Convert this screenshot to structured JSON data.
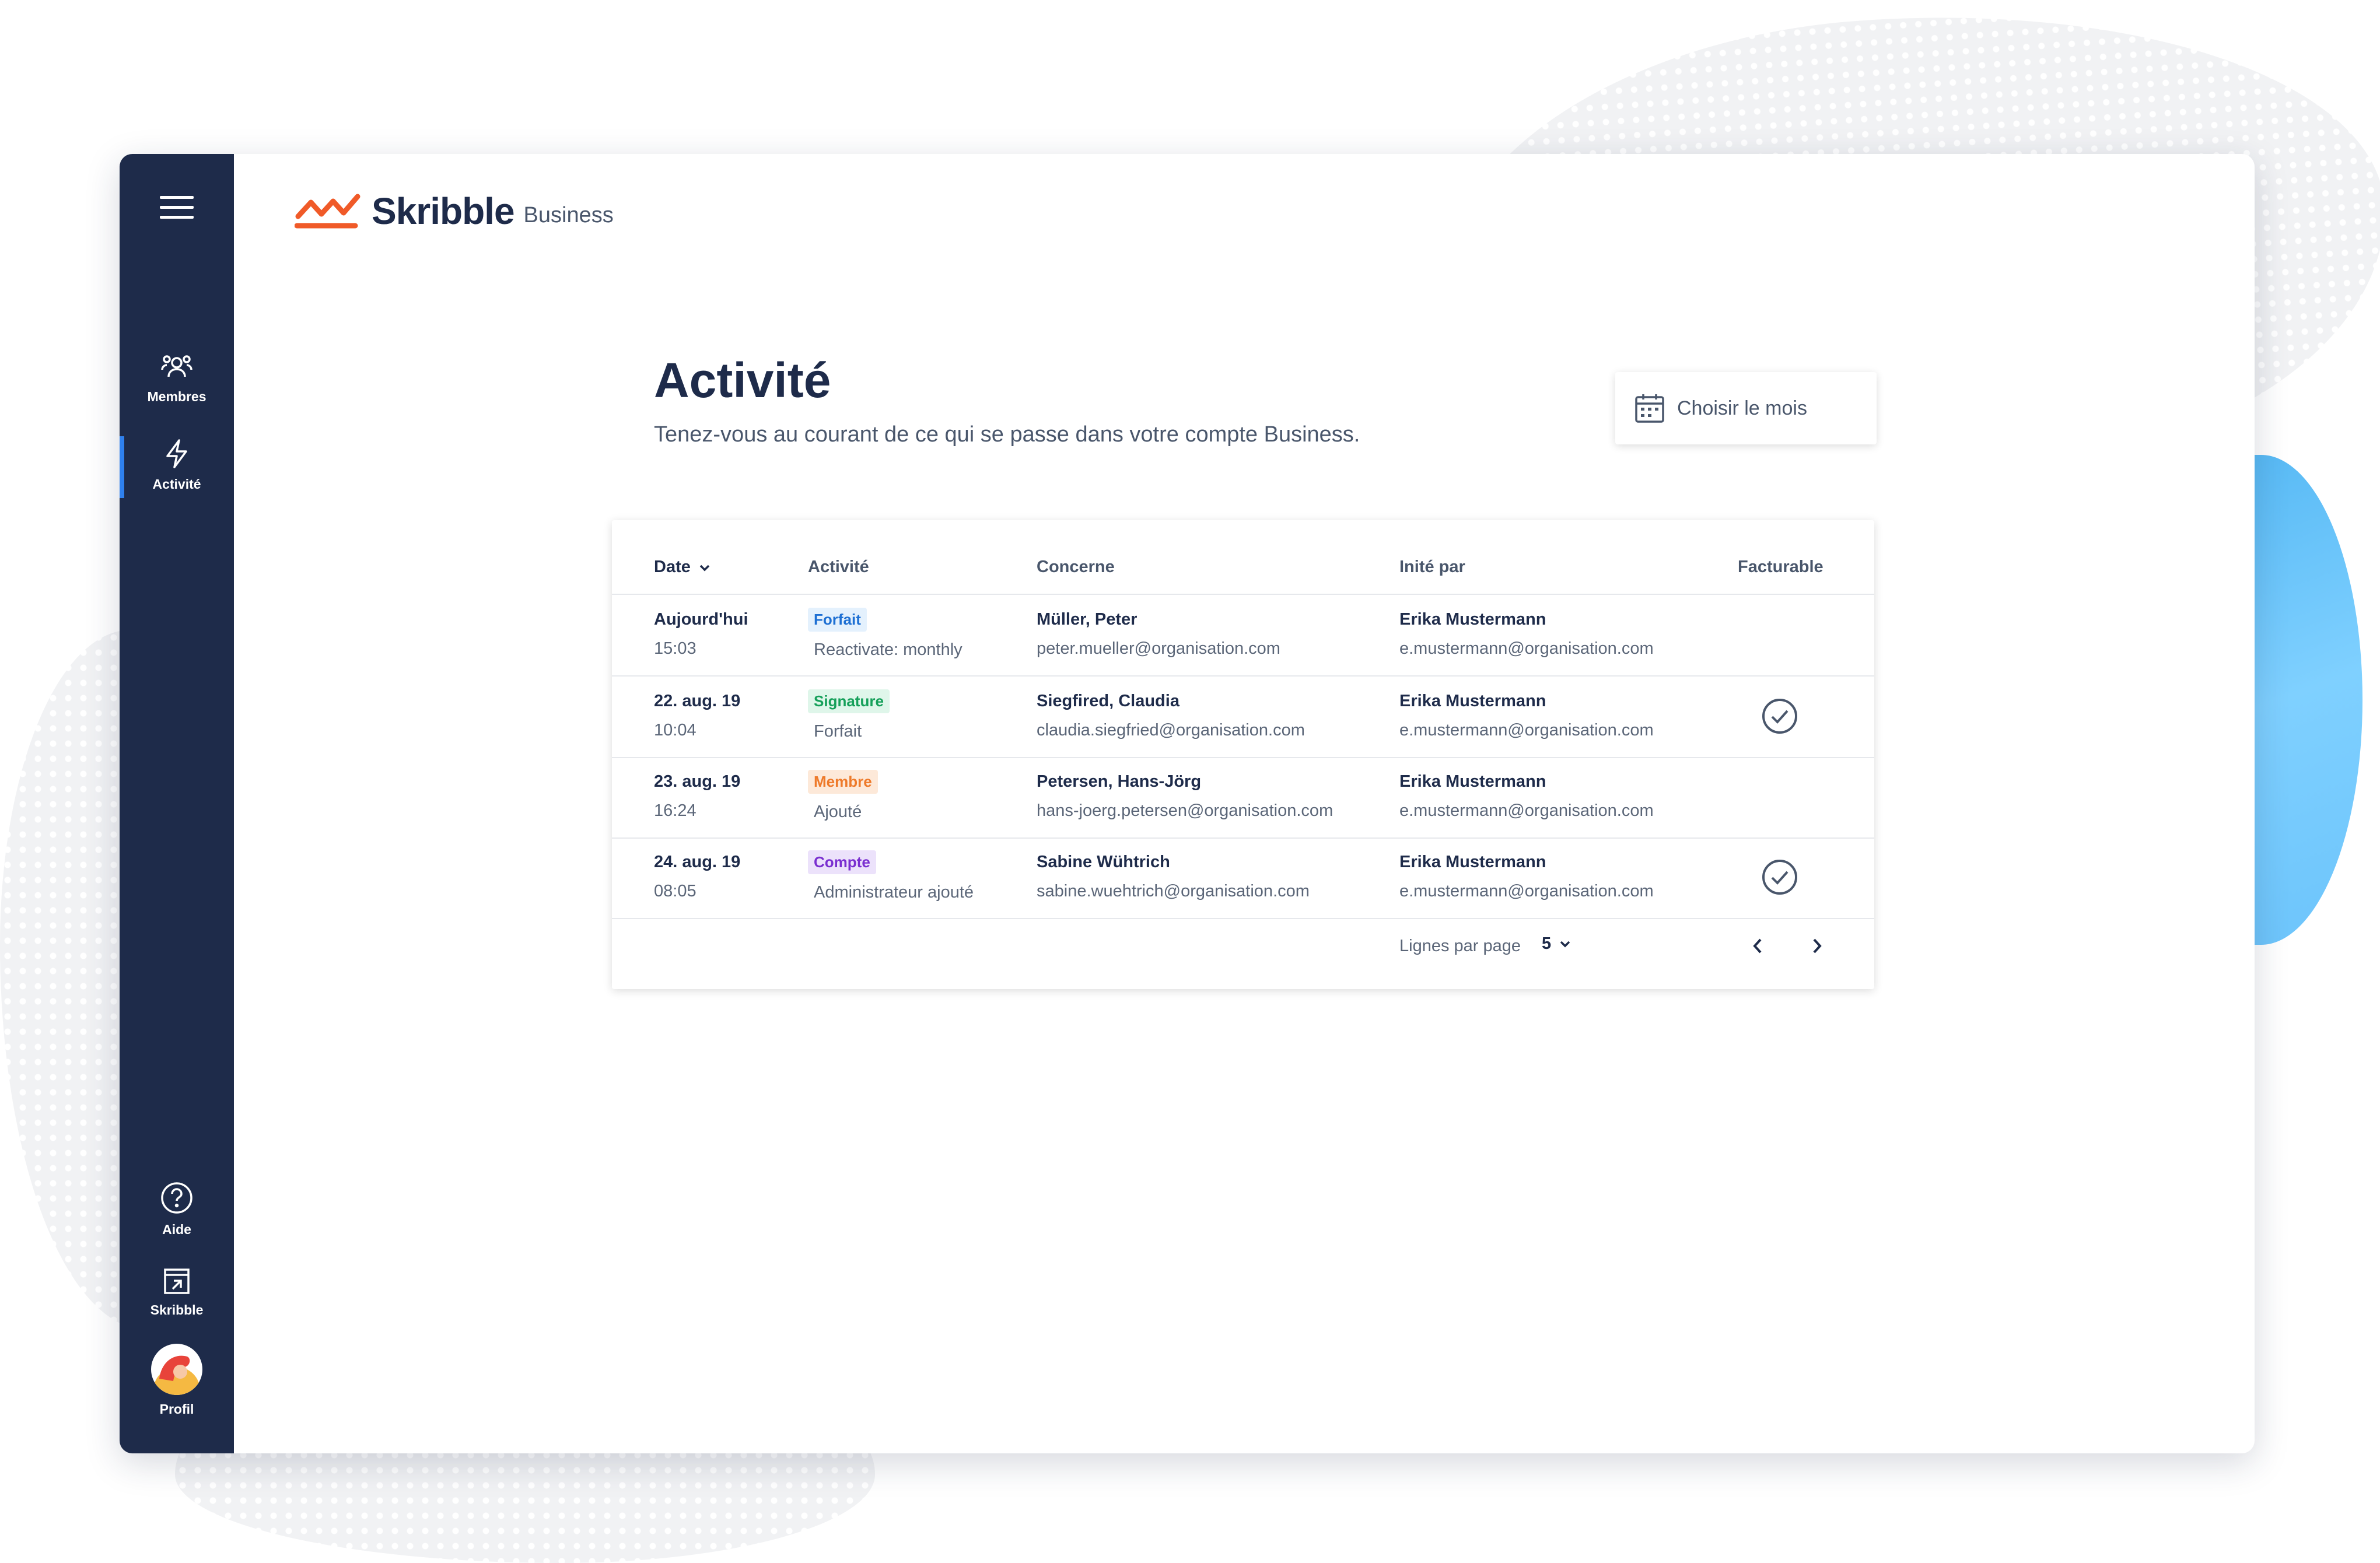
{
  "brand": {
    "name": "Skribble",
    "product": "Business"
  },
  "sidebar": {
    "items": [
      {
        "label": "Membres",
        "icon": "users-icon"
      },
      {
        "label": "Activité",
        "icon": "lightning-icon",
        "active": true
      }
    ],
    "bottom_items": [
      {
        "label": "Aide",
        "icon": "help-circle-icon"
      },
      {
        "label": "Skribble",
        "icon": "external-window-icon"
      },
      {
        "label": "Profil",
        "icon": "avatar"
      }
    ]
  },
  "header": {
    "title": "Activité",
    "subtitle": "Tenez-vous au courant de ce qui se passe dans votre compte Business."
  },
  "month_picker": {
    "label": "Choisir le mois",
    "icon": "calendar-icon"
  },
  "table": {
    "columns": [
      "Date",
      "Activité",
      "Concerne",
      "Inité par",
      "Facturable"
    ],
    "rows": [
      {
        "date": "Aujourd'hui",
        "time": "15:03",
        "badge": "Forfait",
        "badge_color": "#1d6fd3",
        "detail": "Reactivate: monthly",
        "name": "Müller, Peter",
        "email": "peter.mueller@organisation.com",
        "by_name": "Erika Mustermann",
        "by_email": "e.mustermann@organisation.com",
        "billable": false
      },
      {
        "date": "22. aug. 19",
        "time": "10:04",
        "badge": "Signature",
        "badge_color": "#16a05a",
        "detail": "Forfait",
        "name": "Siegfired, Claudia",
        "email": "claudia.siegfried@organisation.com",
        "by_name": "Erika Mustermann",
        "by_email": "e.mustermann@organisation.com",
        "billable": true
      },
      {
        "date": "23. aug. 19",
        "time": "16:24",
        "badge": "Membre",
        "badge_color": "#ee7a2a",
        "detail": "Ajouté",
        "name": "Petersen, Hans-Jörg",
        "email": "hans-joerg.petersen@organisation.com",
        "by_name": "Erika Mustermann",
        "by_email": "e.mustermann@organisation.com",
        "billable": false
      },
      {
        "date": "24. aug. 19",
        "time": "08:05",
        "badge": "Compte",
        "badge_color": "#7a2fd0",
        "detail": "Administrateur ajouté",
        "name": "Sabine Wühtrich",
        "email": "sabine.wuehtrich@organisation.com",
        "by_name": "Erika Mustermann",
        "by_email": "e.mustermann@organisation.com",
        "billable": true
      }
    ],
    "pagination": {
      "rows_per_page_label": "Lignes par page",
      "rows_per_page": "5"
    }
  },
  "colors": {
    "sidebar": "#1e2b4a",
    "accent": "#2f80ed",
    "logo": "#f05a28"
  }
}
